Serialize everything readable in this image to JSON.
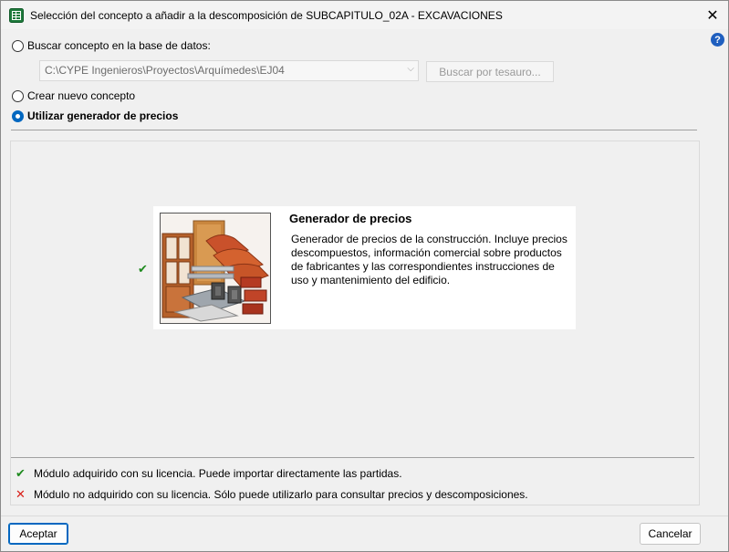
{
  "window": {
    "title": "Selección del concepto a añadir a la descomposición de SUBCAPITULO_02A - EXCAVACIONES",
    "close_label": "✕",
    "help_label": "?"
  },
  "options": {
    "search_db_label": "Buscar concepto en la base de datos:",
    "db_path": "C:\\CYPE Ingenieros\\Proyectos\\Arquímedes\\EJ04",
    "search_thesaurus_label": "Buscar por tesauro...",
    "new_concept_label": "Crear nuevo concepto",
    "price_generator_label": "Utilizar generador de precios",
    "selected": "price_generator"
  },
  "generator": {
    "title": "Generador de precios",
    "description": "Generador de precios de la construcción. Incluye precios descompuestos, información comercial sobre productos de fabricantes y las correspondientes instrucciones de uso y mantenimiento del edificio.",
    "status": "acquired"
  },
  "legend": {
    "acquired_text": "Módulo adquirido con su licencia. Puede importar directamente las partidas.",
    "not_acquired_text": "Módulo no adquirido con su licencia. Sólo puede utilizarlo para consultar precios y descomposiciones."
  },
  "buttons": {
    "accept_label": "Aceptar",
    "cancel_label": "Cancelar"
  },
  "colors": {
    "accent": "#0067c0",
    "check_green": "#1e8a1e",
    "cross_red": "#d91e18"
  },
  "icons": {
    "app": "spreadsheet-icon",
    "check": "checkmark-icon",
    "cross": "cross-icon",
    "dropdown": "chevron-down-icon"
  }
}
